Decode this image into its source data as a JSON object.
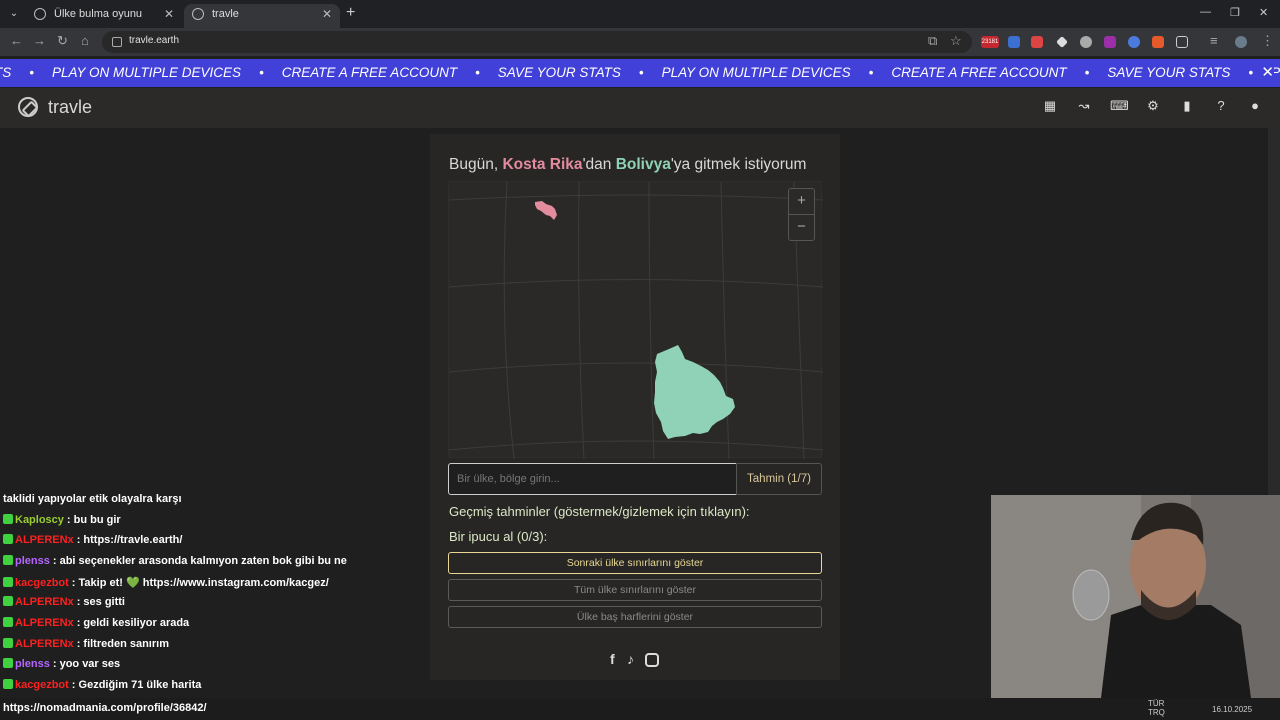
{
  "browser": {
    "tabs": [
      {
        "label": "Ülke bulma oyunu önerileri",
        "active": false
      },
      {
        "label": "travle",
        "active": true
      }
    ],
    "url": "travle.earth",
    "ext_badge": "23181"
  },
  "promo": {
    "items": [
      "PLAY ON MULTIPLE DEVICES",
      "CREATE A FREE ACCOUNT",
      "SAVE YOUR STATS",
      "PLAY ON MULTIPLE DEVICES",
      "CREATE A FREE ACCOUNT",
      "SAVE YOUR STATS",
      "PLAY ON MULTIPLE DEVI"
    ],
    "lead": "TS",
    "close": "✕"
  },
  "app": {
    "title": "travle",
    "icons": [
      "calendar-icon",
      "route-icon",
      "gamepad-icon",
      "gear-icon",
      "stats-icon",
      "help-icon",
      "user-icon"
    ]
  },
  "game": {
    "heading_prefix": "Bugün, ",
    "from_country": "Kosta Rika",
    "heading_mid": "'dan ",
    "to_country": "Bolivya",
    "heading_suffix": "'ya gitmek istiyorum",
    "from_color": "#e28c9e",
    "to_color": "#8fd2b8",
    "zoom_in": "+",
    "zoom_out": "−",
    "input_placeholder": "Bir ülke, bölge girin...",
    "guess_button": "Tahmin (1/7)",
    "past_guesses": "Geçmiş tahminler (göstermek/gizlemek için tıklayın):",
    "hint_label": "Bir ipucu al (0/3):",
    "hint_buttons": [
      "Sonraki ülke sınırlarını göster",
      "Tüm ülke sınırlarını göster",
      "Ülke baş harflerini göster"
    ],
    "social": [
      "facebook-icon",
      "tiktok-icon",
      "instagram-icon"
    ]
  },
  "chat": [
    {
      "user": "",
      "text": "taklidi yapıyolar etik olayalra karşı",
      "color": "#ffffff"
    },
    {
      "user": "Kaploscy",
      "text": ": bu bu gir",
      "color": "#9acd32"
    },
    {
      "user": "ALPERENx",
      "text": ": https://travle.earth/",
      "color": "#ff2020"
    },
    {
      "user": "plenss",
      "text": ": abi seçenekler arasonda kalmıyon zaten bok gibi bu ne",
      "color": "#b466ff"
    },
    {
      "user": "kacgezbot",
      "text": ": Takip et! 💚 https://www.instagram.com/kacgez/",
      "color": "#ff2020"
    },
    {
      "user": "ALPERENx",
      "text": ": ses gitti",
      "color": "#ff2020"
    },
    {
      "user": "ALPERENx",
      "text": ": geldi kesiliyor arada",
      "color": "#ff2020"
    },
    {
      "user": "ALPERENx",
      "text": ": filtreden sanırım",
      "color": "#ff2020"
    },
    {
      "user": "plenss",
      "text": ": yoo var ses",
      "color": "#b466ff"
    },
    {
      "user": "kacgezbot",
      "text": ": Gezdiğim 71 ülke harita",
      "color": "#ff2020"
    }
  ],
  "status_url": "https://nomadmania.com/profile/36842/",
  "tray": {
    "lang1": "TÜR",
    "lang2": "TRQ",
    "date": "16.10.2025"
  }
}
